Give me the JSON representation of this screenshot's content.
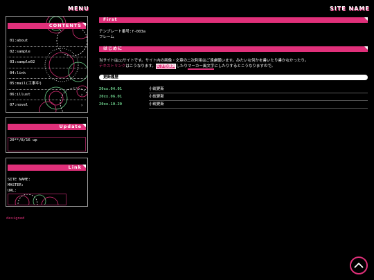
{
  "header": {
    "menu_label": "MENU",
    "site_name": "SITE NAME"
  },
  "sidebar": {
    "contents_title": "CONTENTS",
    "nav": [
      {
        "label": "01:about",
        "arrow": ""
      },
      {
        "label": "02:sample",
        "arrow": ""
      },
      {
        "label": "03:sample02",
        "arrow": ""
      },
      {
        "label": "04:link",
        "arrow": ""
      },
      {
        "label": "05:mail(工事中)",
        "arrow": ""
      },
      {
        "label": "06:illust",
        "arrow": "›"
      },
      {
        "label": "07:novel",
        "arrow": "›"
      }
    ],
    "update_title": "Update",
    "update_text": "20**/8/16 up",
    "link_title": "Link",
    "link_lines": [
      "SITE NAME:",
      "MASTER:",
      "URL:"
    ],
    "designed": "designed"
  },
  "main": {
    "first_title": "First",
    "template_line": "テンプレート番号:f-003a",
    "frame_line": "フレーム",
    "intro_title": "はじめに",
    "intro_line1": "当サイトは○○サイトです。サイト内の画像・文章の二次利用はご遠慮願います。みたいな何かを書いたり書かなかったり。",
    "intro_line2_a": "テキストリンク",
    "intro_line2_b": "はこうなります。",
    "intro_line2_c": "文字色強調",
    "intro_line2_d": "したり",
    "intro_line2_e": "マーカー風文字",
    "intro_line2_f": "にしたりするとこうなりますので。",
    "history_title": "更新履歴",
    "history": [
      {
        "date": "20xx.04.01",
        "text": "小説更新"
      },
      {
        "date": "20xx.06.01",
        "text": "小説更新"
      },
      {
        "date": "20xx.10.20",
        "text": "小説更新"
      }
    ]
  },
  "colors": {
    "accent": "#e0307a",
    "date_green": "#6dd08c",
    "link_pink": "#e0307a"
  }
}
